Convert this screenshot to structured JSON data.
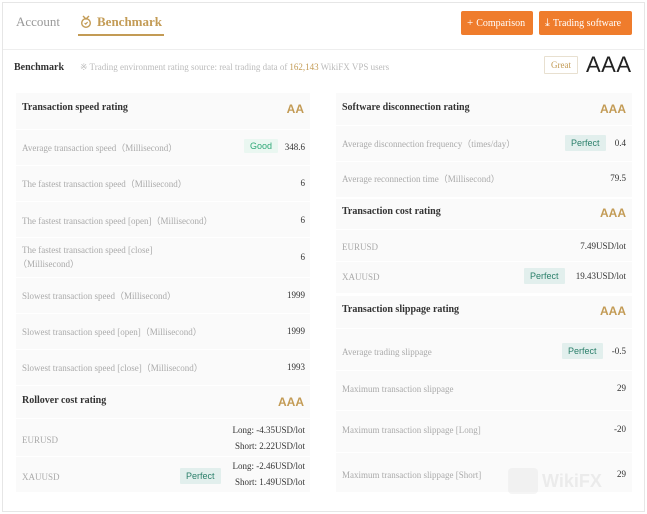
{
  "header": {
    "tabs": [
      {
        "label": "Account"
      },
      {
        "label": "Benchmark"
      }
    ],
    "buttons": {
      "comparison": "Comparison",
      "trading_software": "Trading software"
    }
  },
  "benchmark": {
    "label": "Benchmark",
    "note_prefix": "Trading environment rating source: real trading data of",
    "user_count": "162,143",
    "note_suffix": "WikiFX VPS users",
    "badge": "Great",
    "grade": "AAA"
  },
  "panels": {
    "transaction_speed": {
      "title": "Transaction speed rating",
      "grade": "AA",
      "rows": [
        {
          "label": "Average transaction speed（Millisecond）",
          "value": "348.6",
          "badge": "Good"
        },
        {
          "label": "The fastest transaction speed（Millisecond）",
          "value": "6"
        },
        {
          "label": "The fastest transaction speed [open]（Millisecond）",
          "value": "6"
        },
        {
          "label": "The fastest transaction speed [close]",
          "label2": "（Millisecond）",
          "value": "6"
        },
        {
          "label": "Slowest transaction speed（Millisecond）",
          "value": "1999"
        },
        {
          "label": "Slowest transaction speed [open]（Millisecond）",
          "value": "1999"
        },
        {
          "label": "Slowest transaction speed [close]（Millisecond）",
          "value": "1993"
        }
      ]
    },
    "rollover": {
      "title": "Rollover cost rating",
      "grade": "AAA",
      "rows": [
        {
          "label": "EURUSD",
          "long": "Long: -4.35USD/lot",
          "short": "Short: 2.22USD/lot"
        },
        {
          "label": "XAUUSD",
          "badge": "Perfect",
          "long": "Long: -2.46USD/lot",
          "short": "Short: 1.49USD/lot"
        }
      ]
    },
    "software_disconnection": {
      "title": "Software disconnection rating",
      "grade": "AAA",
      "rows": [
        {
          "label": "Average disconnection frequency（times/day）",
          "value": "0.4",
          "badge": "Perfect"
        },
        {
          "label": "Average reconnection time（Millisecond）",
          "value": "79.5"
        }
      ]
    },
    "transaction_cost": {
      "title": "Transaction cost rating",
      "grade": "AAA",
      "rows": [
        {
          "label": "EURUSD",
          "value": "7.49USD/lot"
        },
        {
          "label": "XAUUSD",
          "value": "19.43USD/lot",
          "badge": "Perfect"
        }
      ]
    },
    "slippage": {
      "title": "Transaction slippage rating",
      "grade": "AAA",
      "rows": [
        {
          "label": "Average trading slippage",
          "value": "-0.5",
          "badge": "Perfect"
        },
        {
          "label": "Maximum transaction slippage",
          "value": "29"
        },
        {
          "label": "Maximum transaction slippage [Long]",
          "value": "-20"
        },
        {
          "label": "Maximum transaction slippage [Short]",
          "value": "29"
        }
      ]
    }
  },
  "watermark": "WikiFX",
  "colors": {
    "accent_gold": "#c39b55",
    "button_orange": "#ef7c2c",
    "good_green": "#2fa877",
    "perfect_teal": "#2a7f6a"
  }
}
